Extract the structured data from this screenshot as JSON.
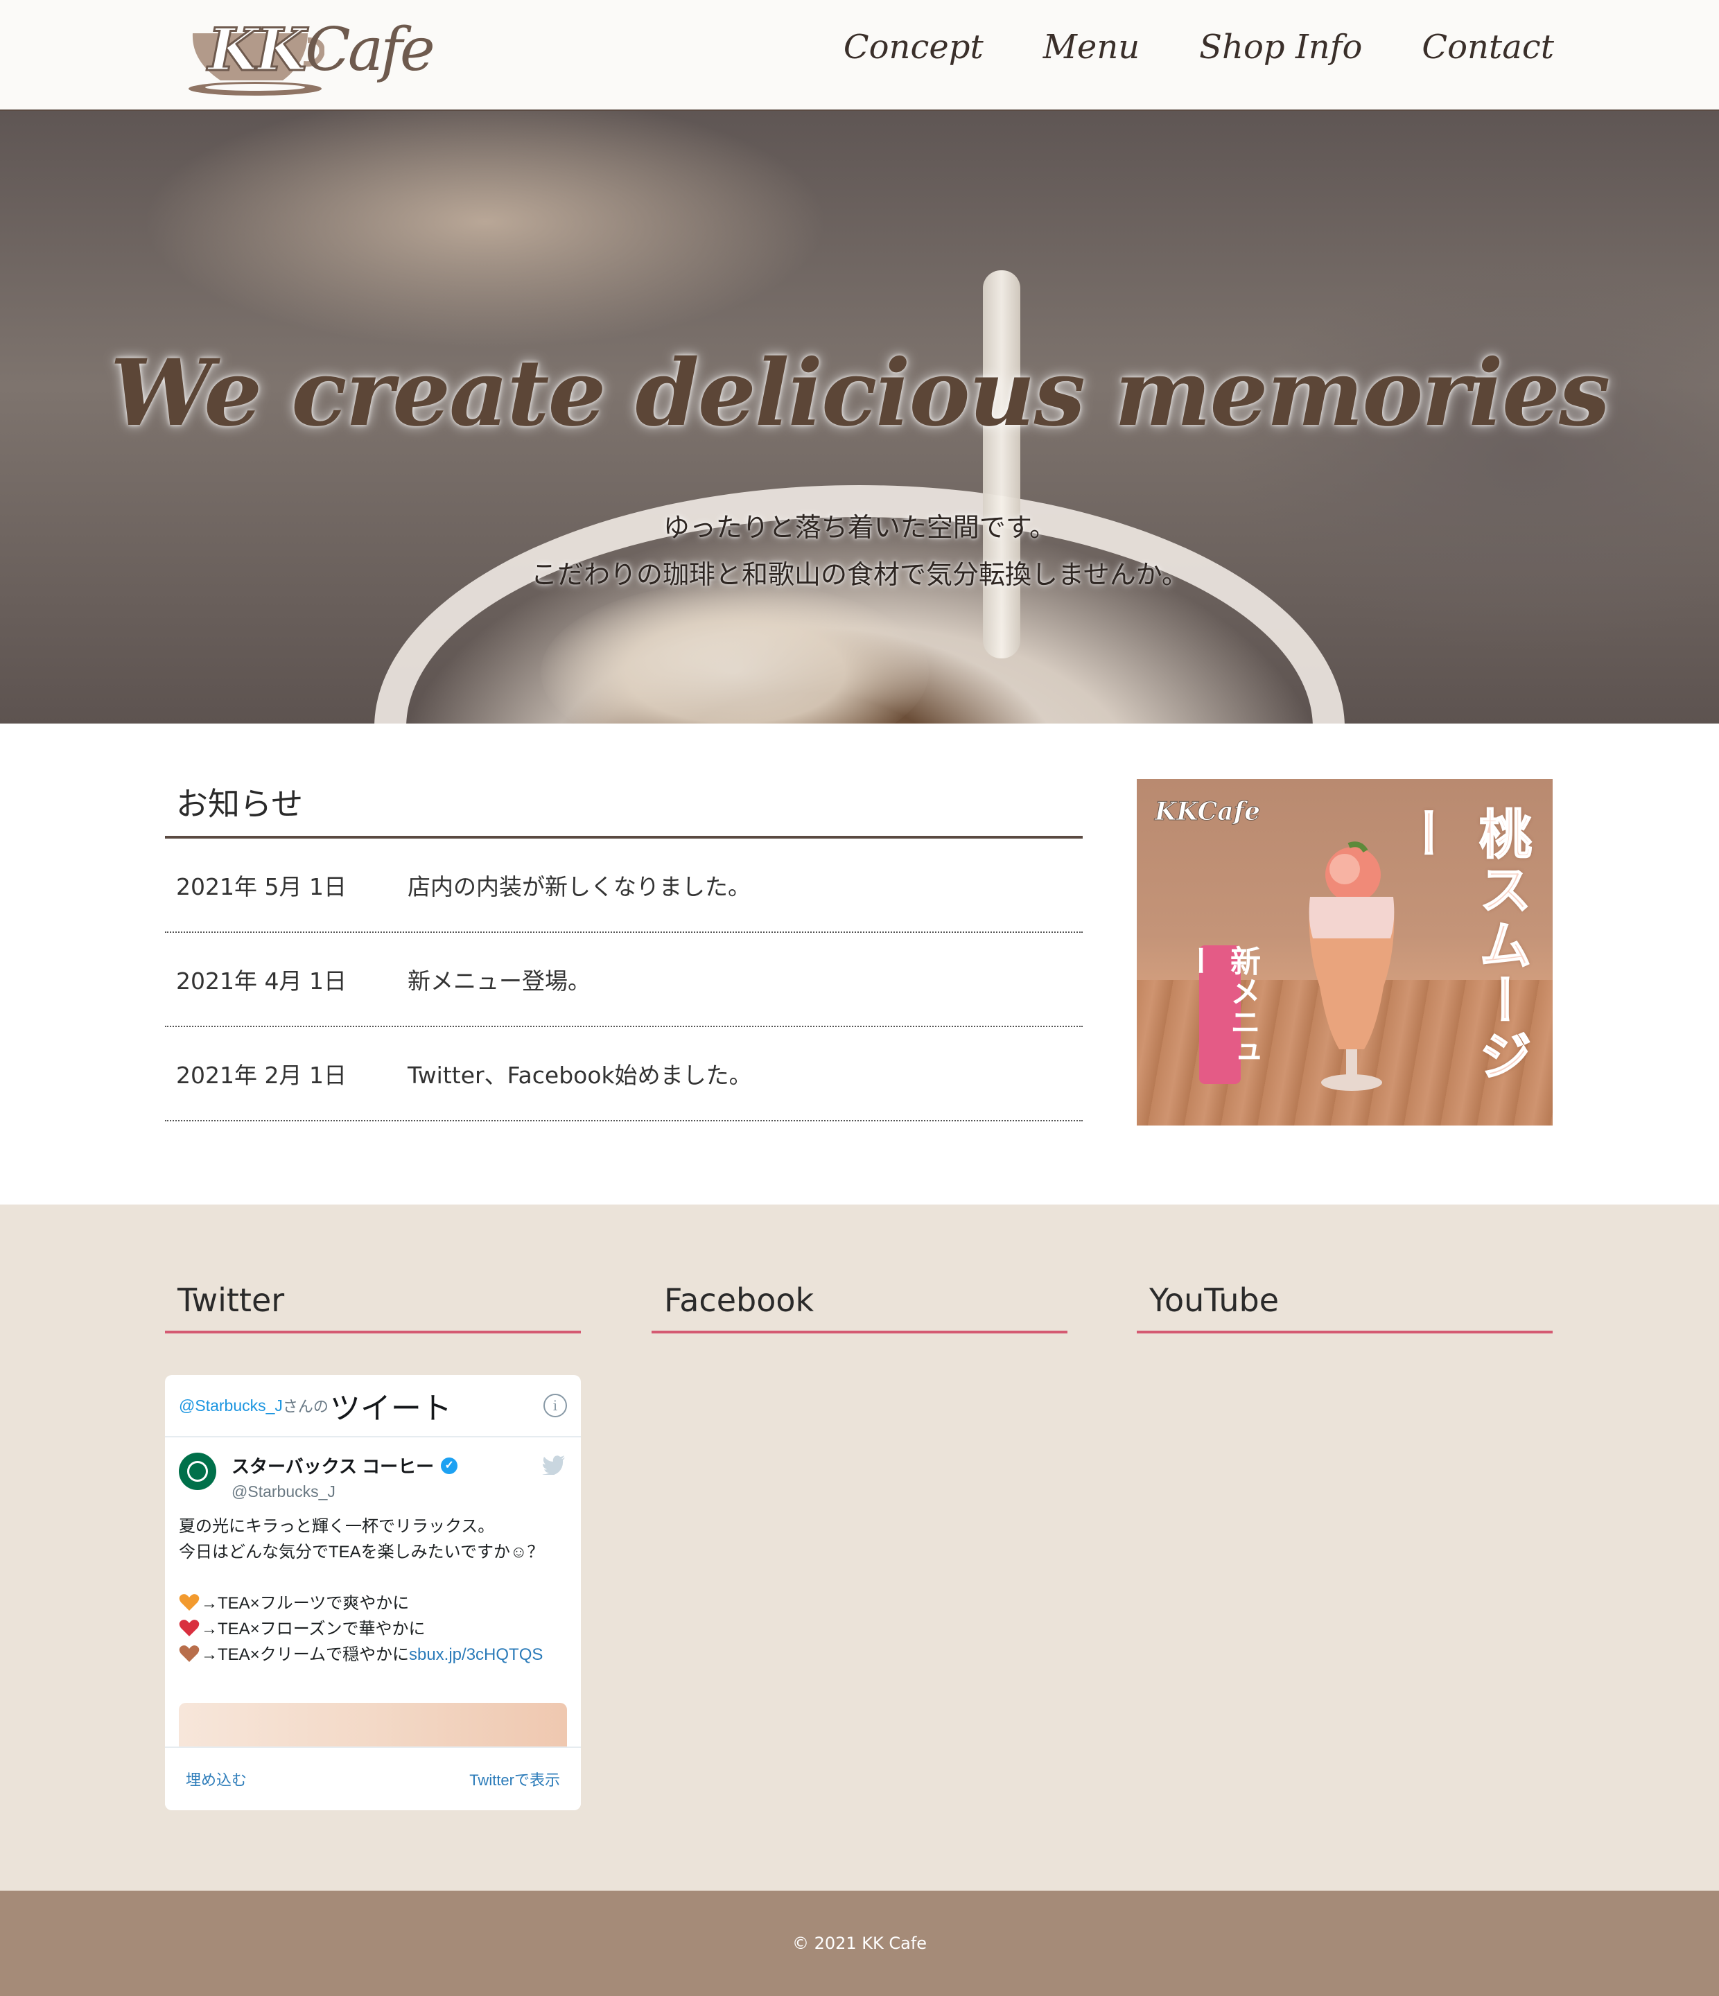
{
  "header": {
    "logo_text_kk": "KK",
    "logo_text_cafe": "Cafe",
    "nav": [
      {
        "label": "Concept"
      },
      {
        "label": "Menu"
      },
      {
        "label": "Shop Info"
      },
      {
        "label": "Contact"
      }
    ]
  },
  "hero": {
    "title": "We create delicious memories",
    "subtitle_line1": "ゆったりと落ち着いた空間です。",
    "subtitle_line2": "こだわりの珈琲と和歌山の食材で気分転換しませんか。",
    "scroll_icon": "chevron-down-icon"
  },
  "news": {
    "title": "お知らせ",
    "items": [
      {
        "date": "2021年 5月 1日",
        "text": "店内の内装が新しくなりました。"
      },
      {
        "date": "2021年 4月 1日",
        "text": "新メニュー登場。"
      },
      {
        "date": "2021年 2月 1日",
        "text": "Twitter、Facebook始めました。"
      }
    ]
  },
  "promo": {
    "logo": "KKCafe",
    "title": "桃スムージー",
    "badge": "新メニュー"
  },
  "social": {
    "twitter_title": "Twitter",
    "facebook_title": "Facebook",
    "youtube_title": "YouTube"
  },
  "twitter_widget": {
    "handle": "@Starbucks_J",
    "handle_suffix": "さんの",
    "header_title": "ツイート",
    "author_name": "スターバックス コーヒー",
    "author_screen_name": "@Starbucks_J",
    "body_line1": "夏の光にキラっと輝く一杯でリラックス。",
    "body_line2": "今日はどんな気分でTEAを楽しみたいですか☺？",
    "body_line3": "→TEA×フルーツで爽やかに",
    "body_line4": "→TEA×フローズンで華やかに",
    "body_line5": "→TEA×クリームで穏やかに",
    "body_link": "sbux.jp/3cHQTQS",
    "embed_label": "埋め込む",
    "view_label": "Twitterで表示",
    "heart_colors": [
      "#f29a2e",
      "#d9303f",
      "#b86e4b"
    ]
  },
  "footer": {
    "copyright": "© 2021 KK Cafe"
  }
}
